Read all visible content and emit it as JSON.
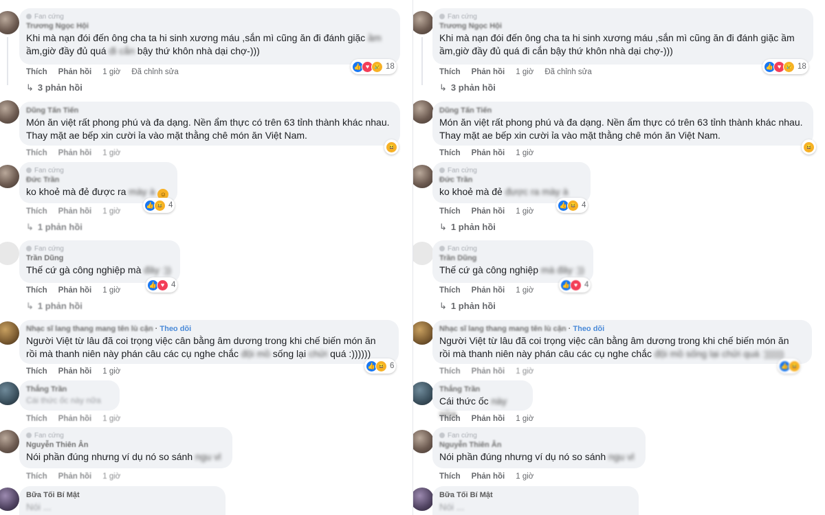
{
  "panels": {
    "left": {
      "comments": [
        {
          "tag": "Fan cứng",
          "name": "Trương Ngọc Hội",
          "text1": "Khi mà nạn đói đến ông cha ta hi sinh xương máu ,sắn mì cũng ăn đi đánh giặc ",
          "blur1": "ầm",
          "text2": "ầm,giờ đầy đủ quá ",
          "blur2": "đi cắn",
          "text3": " bậy thứ khôn nhà dại chợ-)))",
          "like": "Thích",
          "reply": "Phản hồi",
          "time": "1 giờ",
          "edited": "Đã chỉnh sửa",
          "count": "18",
          "replies": "3 phản hồi"
        },
        {
          "name": "Dũng Tấn Tiến",
          "text1": "Món ăn việt rất phong phú và đa dạng. Nền ẩm thực có trên 63 tỉnh thành khác nhau.",
          "text2": "Thay mặt ae bếp xin cười ỉa vào mặt thằng chê món ăn Việt Nam.",
          "like": "Thích",
          "reply": "Phản hồi",
          "time": "1 giờ"
        },
        {
          "tag": "Fan cứng",
          "name": "Đức Trần",
          "text1": "ko khoẻ mà đẻ được ra ",
          "blur1": "mày à",
          "like": "Thích",
          "reply": "Phản hồi",
          "time": "1 giờ",
          "count": "4",
          "replies": "1 phản hồi"
        },
        {
          "tag": "Fan cứng",
          "name": "Trần Dũng",
          "text1": "Thế cứ gà công nghiệp mà ",
          "blur1": "đây :))",
          "like": "Thích",
          "reply": "Phản hồi",
          "time": "1 giờ",
          "count": "4",
          "replies": "1 phản hồi"
        },
        {
          "name": "Nhạc sĩ lang thang mang tên lù cận",
          "follow": "Theo dõi",
          "text1": "Người Việt từ lâu đã coi trọng việc cân bằng âm dương trong khi chế biến món ăn",
          "text2": "rồi mà thanh niên này phán câu các cụ nghe chắc ",
          "blur2": "đội mồ",
          "text3": " sống lại ",
          "blur3": "chửi",
          "text4": " quá :))))))",
          "like": "Thích",
          "reply": "Phản hồi",
          "time": "1 giờ",
          "count": "6"
        },
        {
          "name": "Thắng Trần",
          "text1": "Cái thức ốc này nữa",
          "like": "Thích",
          "reply": "Phản hồi",
          "time": "1 giờ"
        },
        {
          "tag": "Fan cứng",
          "name": "Nguyễn Thiên Ân",
          "text1": "Nói phần đúng nhưng ví dụ nó so sánh ",
          "blur1": "ngu vl",
          "like": "Thích",
          "reply": "Phản hồi",
          "time": "1 giờ"
        },
        {
          "name": "Bữa Tối Bí Mật",
          "text1": "Nói ... ",
          "like": "Thích",
          "reply": "Phản hồi",
          "time": "1 giờ"
        }
      ]
    },
    "right": {
      "comments": [
        {
          "tag": "Fan cứng",
          "name": "Trương Ngọc Hội",
          "text1": "Khi mà nạn đói đến ông cha ta hi sinh xương máu ,sắn mì cũng ăn đi đánh giặc ầm",
          "text2": "ầm,giờ đầy đủ quá đi cắn bậy thứ khôn nhà dại chợ-)))",
          "like": "Thích",
          "reply": "Phản hồi",
          "time": "1 giờ",
          "edited": "Đã chỉnh sửa",
          "count": "18",
          "replies": "3 phản hồi"
        },
        {
          "name": "Dũng Tấn Tiến",
          "text1": "Món ăn việt rất phong phú và đa dạng. Nền ẩm thực có trên 63 tỉnh thành khác nhau.",
          "text2": "Thay mặt ae bếp xin cười ỉa vào mặt thằng chê món ăn Việt Nam.",
          "like": "Thích",
          "reply": "Phản hồi",
          "time": "1 giờ"
        },
        {
          "tag": "Fan cứng",
          "name": "Đức Trần",
          "text1": "ko khoẻ mà đẻ ",
          "blur1": "được ra mày à",
          "like": "Thích",
          "reply": "Phản hồi",
          "time": "1 giờ",
          "count": "4",
          "replies": "1 phản hồi"
        },
        {
          "tag": "Fan cứng",
          "name": "Trần Dũng",
          "text1": "Thế cứ gà công nghiệp ",
          "blur1": "mà đây :))",
          "like": "Thích",
          "reply": "Phản hồi",
          "time": "1 giờ",
          "count": "4",
          "replies": "1 phản hồi"
        },
        {
          "name": "Nhạc sĩ lang thang mang tên lù cận",
          "follow": "Theo dõi",
          "text1": "Người Việt từ lâu đã coi trọng việc cân bằng âm dương trong khi chế biến món ăn",
          "text2": "rồi mà thanh niên này phán câu các cụ nghe chắc ",
          "blur2": "đội mồ sống lại chửi quá :))))))",
          "like": "Thích",
          "reply": "Phản hồi",
          "time": "1 giờ"
        },
        {
          "name": "Thắng Trần",
          "text1": "Cái thức ốc ",
          "blur1": "này nữa",
          "like": "Thích",
          "reply": "Phản hồi",
          "time": "1 giờ"
        },
        {
          "tag": "Fan cứng",
          "name": "Nguyễn Thiên Ân",
          "text1": "Nói phần đúng nhưng ví dụ nó so sánh ",
          "blur1": "ngu vl",
          "like": "Thích",
          "reply": "Phản hồi",
          "time": "1 giờ"
        },
        {
          "name": "Bữa Tối Bí Mật",
          "text1": "Nói ... ",
          "like": "Thích",
          "reply": "Phản hồi",
          "time": "1 giờ"
        }
      ]
    }
  },
  "icons": {
    "like": "like-icon",
    "love": "love-icon",
    "haha": "haha-icon",
    "sad": "sad-icon",
    "reply_arrow": "reply-arrow-icon"
  },
  "colors": {
    "bubble": "#f0f2f5",
    "like": "#1877f2",
    "love": "#f33e58",
    "haha": "#f7b125",
    "follow": "#4a8ad8",
    "meta": "#65676b"
  }
}
